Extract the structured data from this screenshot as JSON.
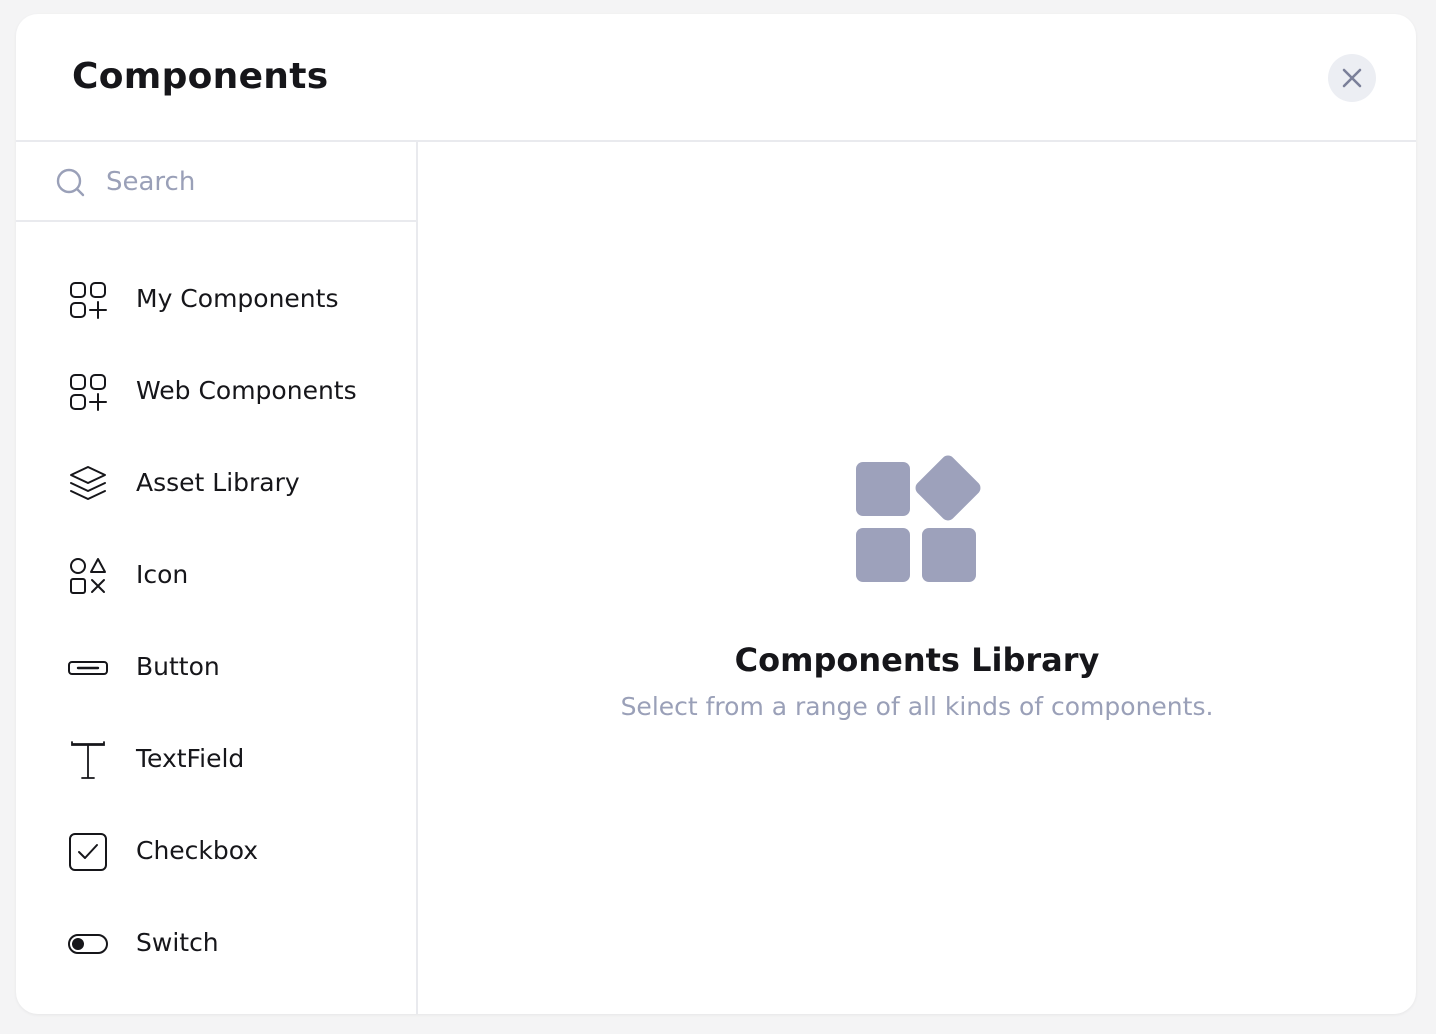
{
  "header": {
    "title": "Components",
    "close_icon": "close-icon"
  },
  "sidebar": {
    "search": {
      "placeholder": "Search",
      "value": "",
      "icon": "search-icon"
    },
    "items": [
      {
        "label": "My Components",
        "icon": "grid-plus-icon"
      },
      {
        "label": "Web Components",
        "icon": "grid-plus-icon"
      },
      {
        "label": "Asset Library",
        "icon": "layers-icon"
      },
      {
        "label": "Icon",
        "icon": "shapes-icon"
      },
      {
        "label": "Button",
        "icon": "button-icon"
      },
      {
        "label": "TextField",
        "icon": "text-icon"
      },
      {
        "label": "Checkbox",
        "icon": "checkbox-icon"
      },
      {
        "label": "Switch",
        "icon": "switch-icon"
      }
    ]
  },
  "main": {
    "empty_state": {
      "icon": "components-library-icon",
      "title": "Components Library",
      "subtitle": "Select from a range of all kinds of components."
    }
  },
  "colors": {
    "text": "#16161a",
    "muted": "#9aa0b8",
    "icon_fill": "#9da1bb",
    "border": "#e9eaee",
    "close_bg": "#eceef3"
  }
}
